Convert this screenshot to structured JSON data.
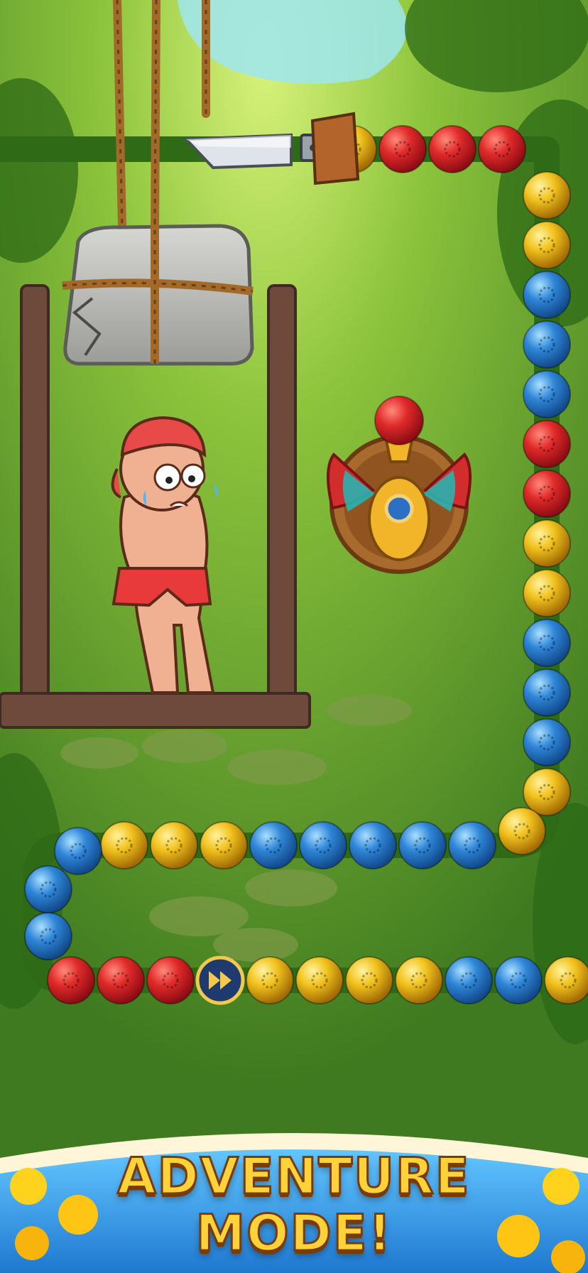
{
  "banner": {
    "line1": "ADVENTURE",
    "line2": "MODE!"
  },
  "colors": {
    "red": "#d8202a",
    "yellow": "#e7b515",
    "blue": "#2f7fd0",
    "track": "#2f6a16",
    "banner_blue": "#2f95e0"
  },
  "marble_chain": {
    "colors": [
      "yellow",
      "red",
      "red",
      "red",
      "yellow",
      "yellow",
      "blue",
      "blue",
      "blue",
      "red",
      "red",
      "yellow",
      "yellow",
      "blue",
      "blue",
      "blue",
      "yellow",
      "yellow",
      "blue",
      "blue",
      "blue",
      "blue",
      "blue",
      "yellow",
      "yellow",
      "yellow",
      "blue",
      "blue",
      "blue",
      "red",
      "red",
      "red",
      "speed",
      "yellow",
      "yellow",
      "yellow",
      "yellow",
      "blue",
      "blue",
      "yellow"
    ]
  },
  "shooter": {
    "icon": "scarab-beetle-shooter-icon",
    "loaded_marble": "red"
  },
  "speed_marker": {
    "icon": "fast-forward-icon"
  },
  "puzzle": {
    "rope_icon": "rope-icon",
    "knife_icon": "knife-icon",
    "boulder_icon": "boulder-icon",
    "character_icon": "scared-boy-character-icon"
  }
}
